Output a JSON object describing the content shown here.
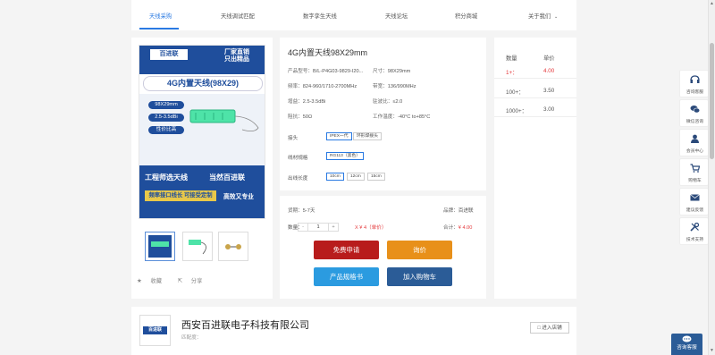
{
  "nav": {
    "items": [
      "天线采购",
      "天线调试匹配",
      "数字孪生天线",
      "天线论坛",
      "积分商城",
      "关于我们"
    ],
    "dropdown_icon": "chevron-down-icon"
  },
  "gallery": {
    "banner": {
      "brand": "百进联",
      "slogan_line1": "厂家直销",
      "slogan_line2": "只出精品",
      "product": "4G内置天线(98X29)",
      "size_tag": "98X29mm",
      "gain_tag": "2.5-3.5dBi",
      "value_tag": "性价比高",
      "bottom_left": "工程师选天线",
      "bottom_right": "当然百进联",
      "footer_left": "频率接口线长 可接受定制",
      "footer_right": "高效又专业"
    },
    "favorite": "收藏",
    "share": "分享"
  },
  "product": {
    "title": "4G内置天线98X29mm",
    "specs": [
      {
        "k": "产品型号：",
        "v": "B/L-P4G03-9829-I20..."
      },
      {
        "k": "尺寸：",
        "v": "98X29mm"
      },
      {
        "k": "频率：",
        "v": "824-960/1710-2700MHz"
      },
      {
        "k": "带宽：",
        "v": "136/990MHz"
      },
      {
        "k": "增益：",
        "v": "2.5-3.5dBi"
      },
      {
        "k": "驻波比：",
        "v": "≤2.0"
      },
      {
        "k": "阻抗：",
        "v": "50Ω"
      },
      {
        "k": "工作温度：",
        "v": "-40°C to+85°C"
      }
    ],
    "connector_label": "接头",
    "connector_options": [
      "IPEX一代",
      "环形焊接头"
    ],
    "cable_label": "线材规格",
    "cable_options": [
      "RG113（黑色）"
    ],
    "length_label": "出线长度",
    "length_options": [
      "10cm",
      "12cm",
      "15cm"
    ]
  },
  "order": {
    "delivery_label": "货期：",
    "delivery_value": "5-7天",
    "brand_label": "品牌：",
    "brand_value": "百进联",
    "qty_label": "数量：",
    "qty_minus": "-",
    "qty_value": "1",
    "qty_plus": "+",
    "unit_price_text": "X ¥ 4（单价）",
    "total_label": "合计：",
    "total_value": "¥ 4.00",
    "btn_free": "免费申请",
    "btn_inquiry": "询价",
    "btn_spec": "产品规格书",
    "btn_cart": "加入购物车",
    "colors": {
      "free": "#b81c1c",
      "inquiry": "#e8901a",
      "spec": "#2b9be0",
      "cart": "#2b5c97"
    }
  },
  "price_table": {
    "header_qty": "数量",
    "header_price": "单价",
    "rows": [
      {
        "qty": "1+：",
        "price": "4.00"
      },
      {
        "qty": "100+：",
        "price": "3.50"
      },
      {
        "qty": "1000+：",
        "price": "3.00"
      }
    ]
  },
  "company": {
    "name": "西安百进联电子科技有限公司",
    "sub": "匹配度：",
    "enter_store": "进入店铺"
  },
  "sidebar": [
    {
      "icon": "headset-icon",
      "label": "咨询客服"
    },
    {
      "icon": "chat-icon",
      "label": "微信咨询"
    },
    {
      "icon": "user-icon",
      "label": "会员中心"
    },
    {
      "icon": "cart-icon",
      "label": "购物车"
    },
    {
      "icon": "mail-icon",
      "label": "建议反馈"
    },
    {
      "icon": "tools-icon",
      "label": "技术支持"
    }
  ],
  "online_service": "咨询客服"
}
